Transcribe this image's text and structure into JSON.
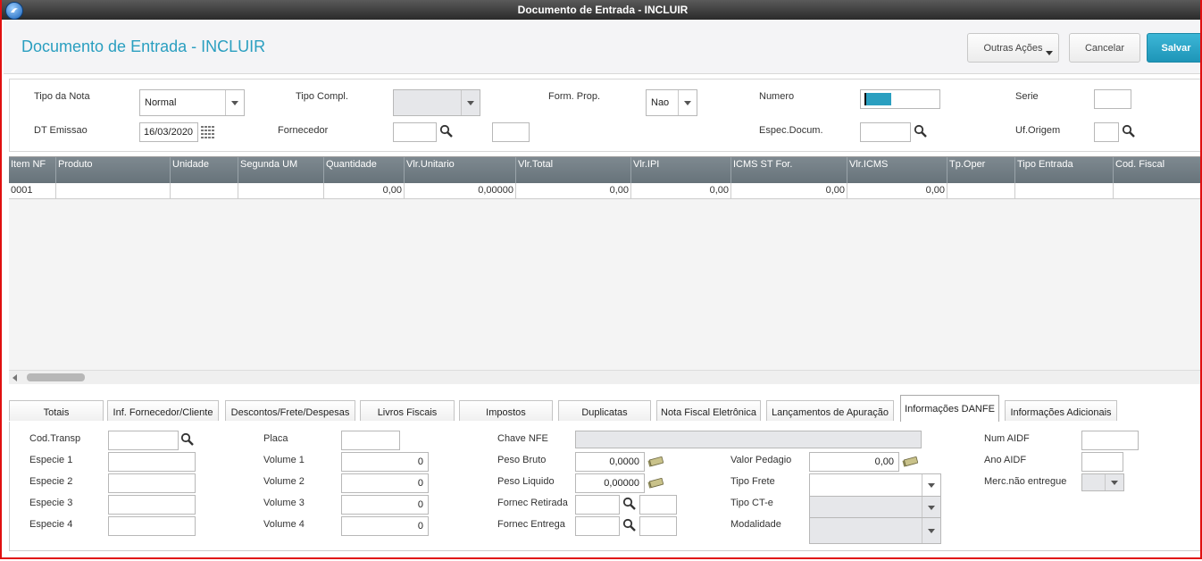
{
  "window": {
    "title": "Documento de Entrada - INCLUIR"
  },
  "header": {
    "title": "Documento de Entrada - INCLUIR",
    "outras_label": "Outras Ações",
    "cancel_label": "Cancelar",
    "save_label": "Salvar"
  },
  "form": {
    "tipo_nota_label": "Tipo da Nota",
    "tipo_nota_value": "Normal",
    "tipo_compl_label": "Tipo Compl.",
    "form_prop_label": "Form. Prop.",
    "form_prop_value": "Nao",
    "numero_label": "Numero",
    "serie_label": "Serie",
    "dt_emissao_label": "DT Emissao",
    "dt_emissao_value": "16/03/2020",
    "fornecedor_label": "Fornecedor",
    "espec_docum_label": "Espec.Docum.",
    "uf_origem_label": "Uf.Origem"
  },
  "grid": {
    "columns": [
      "Item NF",
      "Produto",
      "Unidade",
      "Segunda UM",
      "Quantidade",
      "Vlr.Unitario",
      "Vlr.Total",
      "Vlr.IPI",
      "ICMS ST For.",
      "Vlr.ICMS",
      "Tp.Oper",
      "Tipo Entrada",
      "Cod. Fiscal"
    ],
    "row": [
      "0001",
      "",
      "",
      "",
      "0,00",
      "0,00000",
      "0,00",
      "0,00",
      "0,00",
      "0,00",
      "",
      "",
      ""
    ]
  },
  "tabs": [
    "Totais",
    "Inf. Fornecedor/Cliente",
    "Descontos/Frete/Despesas",
    "Livros Fiscais",
    "Impostos",
    "Duplicatas",
    "Nota Fiscal Eletrônica",
    "Lançamentos de Apuração",
    "Informações DANFE",
    "Informações Adicionais"
  ],
  "danfe": {
    "cod_transp_label": "Cod.Transp",
    "especie1_label": "Especie 1",
    "especie2_label": "Especie 2",
    "especie3_label": "Especie 3",
    "especie4_label": "Especie 4",
    "placa_label": "Placa",
    "volume1_label": "Volume 1",
    "volume2_label": "Volume 2",
    "volume3_label": "Volume 3",
    "volume4_label": "Volume 4",
    "volume1_value": "0",
    "volume2_value": "0",
    "volume3_value": "0",
    "volume4_value": "0",
    "chave_nfe_label": "Chave NFE",
    "peso_bruto_label": "Peso Bruto",
    "peso_bruto_value": "0,0000",
    "peso_liquido_label": "Peso Liquido",
    "peso_liquido_value": "0,00000",
    "fornec_retirada_label": "Fornec Retirada",
    "fornec_entrega_label": "Fornec Entrega",
    "valor_pedagio_label": "Valor Pedagio",
    "valor_pedagio_value": "0,00",
    "tipo_frete_label": "Tipo Frete",
    "tipo_cte_label": "Tipo CT-e",
    "modalidade_label": "Modalidade",
    "num_aidf_label": "Num AIDF",
    "ano_aidf_label": "Ano AIDF",
    "merc_label": "Merc.não entregue"
  }
}
